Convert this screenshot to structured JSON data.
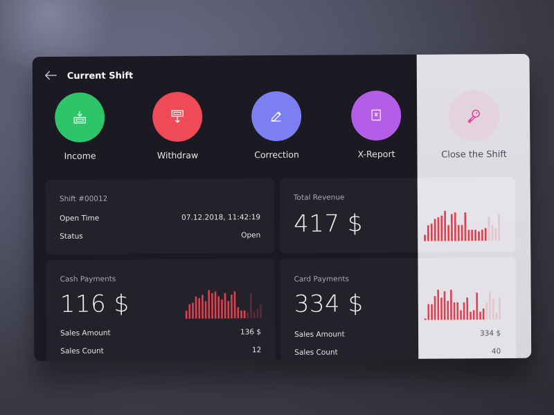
{
  "header": {
    "title": "Current Shift",
    "back_icon": "arrow-left-icon"
  },
  "actions": [
    {
      "label": "Income",
      "icon": "income-icon",
      "color": "#2ec56a"
    },
    {
      "label": "Withdraw",
      "icon": "withdraw-icon",
      "color": "#ef4b57"
    },
    {
      "label": "Correction",
      "icon": "pencil-icon",
      "color": "#7b7ff0"
    },
    {
      "label": "X-Report",
      "icon": "report-icon",
      "color": "#b45ee8"
    },
    {
      "label": "Close the Shift",
      "icon": "key-icon",
      "color": "#d63a9a"
    }
  ],
  "shift": {
    "title": "Shift #00012",
    "open_time_label": "Open Time",
    "open_time_value": "07.12.2018, 11:42:19",
    "status_label": "Status",
    "status_value": "Open"
  },
  "revenue": {
    "title": "Total Revenue",
    "amount": "417 $"
  },
  "cash": {
    "title": "Cash Payments",
    "amount": "116 $",
    "sales_amount_label": "Sales Amount",
    "sales_amount_value": "136 $",
    "sales_count_label": "Sales Count",
    "sales_count_value": "12"
  },
  "card": {
    "title": "Card Payments",
    "amount": "334 $",
    "sales_amount_label": "Sales Amount",
    "sales_amount_value": "334 $",
    "sales_count_label": "Sales Count",
    "sales_count_value": "40"
  },
  "colors": {
    "bar": "#e0404e",
    "bar_faded": "#e0404e"
  },
  "chart_data": [
    {
      "type": "bar",
      "title": "Total Revenue",
      "values": [
        4,
        10,
        11,
        14,
        15,
        16,
        19,
        10,
        17,
        18,
        10,
        10,
        18,
        7,
        7,
        7,
        6,
        7,
        8
      ],
      "faded_values": [
        15,
        10,
        8,
        17
      ],
      "ylim": [
        0,
        20
      ]
    },
    {
      "type": "bar",
      "title": "Cash Payments",
      "values": [
        5,
        9,
        10,
        14,
        13,
        15,
        11,
        18,
        16,
        17,
        14,
        12,
        16,
        11,
        15,
        17,
        7,
        5,
        5
      ],
      "faded_values": [
        4,
        16,
        4,
        6,
        9
      ],
      "ylim": [
        0,
        20
      ]
    },
    {
      "type": "bar",
      "title": "Card Payments",
      "values": [
        1,
        10,
        10,
        15,
        19,
        14,
        18,
        12,
        19,
        11,
        11,
        6,
        11,
        14,
        5,
        6,
        17,
        5,
        7
      ],
      "faded_values": [
        11,
        17,
        13,
        4,
        14
      ],
      "ylim": [
        0,
        20
      ]
    }
  ]
}
